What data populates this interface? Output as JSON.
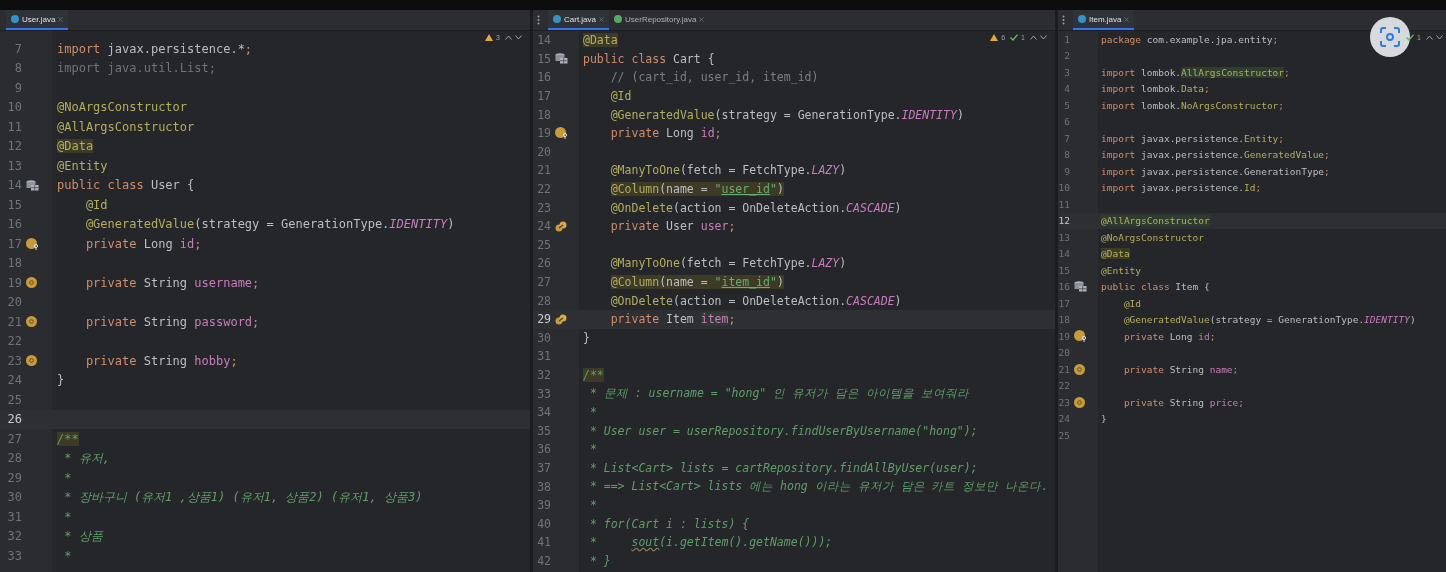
{
  "panes": [
    {
      "tabs": [
        {
          "label": "User.java",
          "kind": "class",
          "selected": true
        }
      ],
      "inspections": {
        "warnings": "3"
      },
      "lines": [
        {
          "number": "7",
          "current": false,
          "tokens": [
            {
              "text": "import",
              "kind": "keyword"
            },
            {
              "text": " javax.persistence.*",
              "kind": "plain"
            },
            {
              "text": ";",
              "kind": "punct"
            }
          ]
        },
        {
          "number": "8",
          "current": false,
          "tokens": [
            {
              "text": "import java.util.List;",
              "kind": "unused"
            }
          ]
        },
        {
          "number": "9",
          "current": false
        },
        {
          "number": "10",
          "current": false,
          "tokens": [
            {
              "text": "@NoArgsConstructor",
              "kind": "annotation"
            }
          ]
        },
        {
          "number": "11",
          "current": false,
          "tokens": [
            {
              "text": "@AllArgsConstructor",
              "kind": "annotation"
            }
          ]
        },
        {
          "number": "12",
          "current": false,
          "tokens": [
            {
              "text": "@Data",
              "kind": "annotation-hl"
            }
          ]
        },
        {
          "number": "13",
          "current": false,
          "tokens": [
            {
              "text": "@Entity",
              "kind": "annotation"
            }
          ]
        },
        {
          "number": "14",
          "current": false,
          "gutter": {
            "kind": "table"
          },
          "tokens": [
            {
              "text": "public class ",
              "kind": "keyword"
            },
            {
              "text": "User {",
              "kind": "plain"
            }
          ]
        },
        {
          "number": "15",
          "current": false,
          "tokens": [
            {
              "text": "    @Id",
              "kind": "annotation"
            }
          ]
        },
        {
          "number": "16",
          "current": false,
          "tokens": [
            {
              "text": "    @GeneratedValue",
              "kind": "annotation"
            },
            {
              "text": "(strategy = GenerationType.",
              "kind": "plain"
            },
            {
              "text": "IDENTITY",
              "kind": "constant"
            },
            {
              "text": ")",
              "kind": "plain"
            }
          ]
        },
        {
          "number": "17",
          "current": false,
          "gutter": {
            "kind": "id-field"
          },
          "tokens": [
            {
              "text": "    private ",
              "kind": "keyword"
            },
            {
              "text": "Long ",
              "kind": "plain"
            },
            {
              "text": "id",
              "kind": "field"
            },
            {
              "text": ";",
              "kind": "punct"
            }
          ]
        },
        {
          "number": "18",
          "current": false
        },
        {
          "number": "19",
          "current": false,
          "gutter": {
            "kind": "field"
          },
          "tokens": [
            {
              "text": "    private ",
              "kind": "keyword"
            },
            {
              "text": "String ",
              "kind": "plain"
            },
            {
              "text": "username",
              "kind": "field"
            },
            {
              "text": ";",
              "kind": "punct"
            }
          ]
        },
        {
          "number": "20",
          "current": false
        },
        {
          "number": "21",
          "current": false,
          "gutter": {
            "kind": "field"
          },
          "tokens": [
            {
              "text": "    private ",
              "kind": "keyword"
            },
            {
              "text": "String ",
              "kind": "plain"
            },
            {
              "text": "password",
              "kind": "field"
            },
            {
              "text": ";",
              "kind": "punct"
            }
          ]
        },
        {
          "number": "22",
          "current": false
        },
        {
          "number": "23",
          "current": false,
          "gutter": {
            "kind": "field"
          },
          "tokens": [
            {
              "text": "    private ",
              "kind": "keyword"
            },
            {
              "text": "String ",
              "kind": "plain"
            },
            {
              "text": "hobby",
              "kind": "field"
            },
            {
              "text": ";",
              "kind": "punct"
            }
          ]
        },
        {
          "number": "24",
          "current": false,
          "tokens": [
            {
              "text": "}",
              "kind": "plain"
            }
          ]
        },
        {
          "number": "25",
          "current": false
        },
        {
          "number": "26",
          "current": true
        },
        {
          "number": "27",
          "current": false,
          "tokens": [
            {
              "text": "/**",
              "kind": "doc-hl"
            }
          ]
        },
        {
          "number": "28",
          "current": false,
          "tokens": [
            {
              "text": " * 유저,",
              "kind": "doc"
            }
          ]
        },
        {
          "number": "29",
          "current": false,
          "tokens": [
            {
              "text": " *",
              "kind": "doc"
            }
          ]
        },
        {
          "number": "30",
          "current": false,
          "tokens": [
            {
              "text": " * 장바구니 (유저1 ,상품1) (유저1, 상품2) (유저1, 상품3)",
              "kind": "doc"
            }
          ]
        },
        {
          "number": "31",
          "current": false,
          "tokens": [
            {
              "text": " *",
              "kind": "doc"
            }
          ]
        },
        {
          "number": "32",
          "current": false,
          "tokens": [
            {
              "text": " * 상품",
              "kind": "doc"
            }
          ]
        },
        {
          "number": "33",
          "current": false,
          "tokens": [
            {
              "text": " *",
              "kind": "doc"
            }
          ]
        }
      ]
    },
    {
      "tabs": [
        {
          "label": "Cart.java",
          "kind": "class",
          "selected": true
        },
        {
          "label": "UserRepository.java",
          "kind": "interface",
          "selected": false
        }
      ],
      "inspections": {
        "warnings": "6",
        "passed": "1"
      },
      "lines": [
        {
          "number": "14",
          "current": false,
          "tokens": [
            {
              "text": "@Data",
              "kind": "annotation-hl"
            }
          ]
        },
        {
          "number": "15",
          "current": false,
          "gutter": {
            "kind": "table"
          },
          "tokens": [
            {
              "text": "public class ",
              "kind": "keyword"
            },
            {
              "text": "Cart {",
              "kind": "plain"
            }
          ]
        },
        {
          "number": "16",
          "current": false,
          "tokens": [
            {
              "text": "    // (cart_id, user_id, item_id)",
              "kind": "comment"
            }
          ]
        },
        {
          "number": "17",
          "current": false,
          "tokens": [
            {
              "text": "    @Id",
              "kind": "annotation"
            }
          ]
        },
        {
          "number": "18",
          "current": false,
          "tokens": [
            {
              "text": "    @GeneratedValue",
              "kind": "annotation"
            },
            {
              "text": "(strategy = GenerationType.",
              "kind": "plain"
            },
            {
              "text": "IDENTITY",
              "kind": "constant"
            },
            {
              "text": ")",
              "kind": "plain"
            }
          ]
        },
        {
          "number": "19",
          "current": false,
          "gutter": {
            "kind": "id-field"
          },
          "tokens": [
            {
              "text": "    private ",
              "kind": "keyword"
            },
            {
              "text": "Long ",
              "kind": "plain"
            },
            {
              "text": "id",
              "kind": "field"
            },
            {
              "text": ";",
              "kind": "punct"
            }
          ]
        },
        {
          "number": "20",
          "current": false
        },
        {
          "number": "21",
          "current": false,
          "tokens": [
            {
              "text": "    @ManyToOne",
              "kind": "annotation"
            },
            {
              "text": "(fetch = FetchType.",
              "kind": "plain"
            },
            {
              "text": "LAZY",
              "kind": "constant"
            },
            {
              "text": ")",
              "kind": "plain"
            }
          ]
        },
        {
          "number": "22",
          "current": false,
          "tokens": [
            {
              "text": "    @Column",
              "kind": "annotation-hl"
            },
            {
              "text": "(name = ",
              "kind": "plain-hl"
            },
            {
              "text": "\"",
              "kind": "string-hl"
            },
            {
              "text": "user_id",
              "kind": "string-ref-hl"
            },
            {
              "text": "\"",
              "kind": "string-hl"
            },
            {
              "text": ")",
              "kind": "plain-hl"
            }
          ]
        },
        {
          "number": "23",
          "current": false,
          "tokens": [
            {
              "text": "    @OnDelete",
              "kind": "annotation"
            },
            {
              "text": "(action = OnDeleteAction.",
              "kind": "plain"
            },
            {
              "text": "CASCADE",
              "kind": "constant"
            },
            {
              "text": ")",
              "kind": "plain"
            }
          ]
        },
        {
          "number": "24",
          "current": false,
          "gutter": {
            "kind": "relation"
          },
          "tokens": [
            {
              "text": "    private ",
              "kind": "keyword"
            },
            {
              "text": "User ",
              "kind": "plain"
            },
            {
              "text": "user",
              "kind": "field"
            },
            {
              "text": ";",
              "kind": "punct"
            }
          ]
        },
        {
          "number": "25",
          "current": false
        },
        {
          "number": "26",
          "current": false,
          "tokens": [
            {
              "text": "    @ManyToOne",
              "kind": "annotation"
            },
            {
              "text": "(fetch = FetchType.",
              "kind": "plain"
            },
            {
              "text": "LAZY",
              "kind": "constant"
            },
            {
              "text": ")",
              "kind": "plain"
            }
          ]
        },
        {
          "number": "27",
          "current": false,
          "tokens": [
            {
              "text": "    @Column",
              "kind": "annotation-hl"
            },
            {
              "text": "(name = ",
              "kind": "plain-hl"
            },
            {
              "text": "\"",
              "kind": "string-hl"
            },
            {
              "text": "item_id",
              "kind": "string-ref-hl"
            },
            {
              "text": "\"",
              "kind": "string-hl"
            },
            {
              "text": ")",
              "kind": "plain-hl"
            }
          ]
        },
        {
          "number": "28",
          "current": false,
          "tokens": [
            {
              "text": "    @OnDelete",
              "kind": "annotation"
            },
            {
              "text": "(action = OnDeleteAction.",
              "kind": "plain"
            },
            {
              "text": "CASCADE",
              "kind": "constant"
            },
            {
              "text": ")",
              "kind": "plain"
            }
          ]
        },
        {
          "number": "29",
          "current": true,
          "gutter": {
            "kind": "relation"
          },
          "tokens": [
            {
              "text": "    private ",
              "kind": "keyword"
            },
            {
              "text": "Item ",
              "kind": "plain"
            },
            {
              "text": "item",
              "kind": "field-hl"
            },
            {
              "text": ";",
              "kind": "punct"
            }
          ]
        },
        {
          "number": "30",
          "current": false,
          "tokens": [
            {
              "text": "}",
              "kind": "plain"
            }
          ]
        },
        {
          "number": "31",
          "current": false
        },
        {
          "number": "32",
          "current": false,
          "tokens": [
            {
              "text": "/**",
              "kind": "doc-hl"
            }
          ]
        },
        {
          "number": "33",
          "current": false,
          "tokens": [
            {
              "text": " * 문제 : username = \"hong\" 인 유저가 담은 아이템을 보여줘라",
              "kind": "doc"
            }
          ]
        },
        {
          "number": "34",
          "current": false,
          "tokens": [
            {
              "text": " *",
              "kind": "doc"
            }
          ]
        },
        {
          "number": "35",
          "current": false,
          "tokens": [
            {
              "text": " * User user = userRepository.findUserByUsername(\"hong\");",
              "kind": "doc"
            }
          ]
        },
        {
          "number": "36",
          "current": false,
          "tokens": [
            {
              "text": " *",
              "kind": "doc"
            }
          ]
        },
        {
          "number": "37",
          "current": false,
          "tokens": [
            {
              "text": " * List<Cart> lists = cartRepository.findAllByUser(user);",
              "kind": "doc"
            }
          ]
        },
        {
          "number": "38",
          "current": false,
          "tokens": [
            {
              "text": " * ==> List<Cart> lists 에는 hong 이라는 유저가 담은 카트 정보만 나온다.",
              "kind": "doc"
            }
          ]
        },
        {
          "number": "39",
          "current": false,
          "tokens": [
            {
              "text": " *",
              "kind": "doc"
            }
          ]
        },
        {
          "number": "40",
          "current": false,
          "tokens": [
            {
              "text": " * for(Cart i : lists) {",
              "kind": "doc"
            }
          ]
        },
        {
          "number": "41",
          "current": false,
          "tokens": [
            {
              "text": " *     ",
              "kind": "doc"
            },
            {
              "text": "sout",
              "kind": "doc-squiggle"
            },
            {
              "text": "(i.getItem().getName()));",
              "kind": "doc"
            }
          ]
        },
        {
          "number": "42",
          "current": false,
          "tokens": [
            {
              "text": " * }",
              "kind": "doc"
            }
          ]
        }
      ]
    },
    {
      "tabs": [
        {
          "label": "Item.java",
          "kind": "class",
          "selected": true
        }
      ],
      "inspections": {
        "passed": "1"
      },
      "lines": [
        {
          "number": "1",
          "current": false,
          "tokens": [
            {
              "text": "package ",
              "kind": "keyword"
            },
            {
              "text": "com.example.jpa.entity",
              "kind": "plain"
            },
            {
              "text": ";",
              "kind": "punct"
            }
          ]
        },
        {
          "number": "2",
          "current": false
        },
        {
          "number": "3",
          "current": false,
          "tokens": [
            {
              "text": "import ",
              "kind": "keyword"
            },
            {
              "text": "lombok.",
              "kind": "plain"
            },
            {
              "text": "AllArgsConstructor",
              "kind": "annotation-hl-alt"
            },
            {
              "text": ";",
              "kind": "punct"
            }
          ]
        },
        {
          "number": "4",
          "current": false,
          "tokens": [
            {
              "text": "import ",
              "kind": "keyword"
            },
            {
              "text": "lombok.",
              "kind": "plain"
            },
            {
              "text": "Data",
              "kind": "annotation"
            },
            {
              "text": ";",
              "kind": "punct"
            }
          ]
        },
        {
          "number": "5",
          "current": false,
          "tokens": [
            {
              "text": "import ",
              "kind": "keyword"
            },
            {
              "text": "lombok.",
              "kind": "plain"
            },
            {
              "text": "NoArgsConstructor",
              "kind": "annotation"
            },
            {
              "text": ";",
              "kind": "punct"
            }
          ]
        },
        {
          "number": "6",
          "current": false
        },
        {
          "number": "7",
          "current": false,
          "tokens": [
            {
              "text": "import ",
              "kind": "keyword"
            },
            {
              "text": "javax.persistence.",
              "kind": "plain"
            },
            {
              "text": "Entity",
              "kind": "annotation"
            },
            {
              "text": ";",
              "kind": "punct"
            }
          ]
        },
        {
          "number": "8",
          "current": false,
          "tokens": [
            {
              "text": "import ",
              "kind": "keyword"
            },
            {
              "text": "javax.persistence.",
              "kind": "plain"
            },
            {
              "text": "GeneratedValue",
              "kind": "annotation"
            },
            {
              "text": ";",
              "kind": "punct"
            }
          ]
        },
        {
          "number": "9",
          "current": false,
          "tokens": [
            {
              "text": "import ",
              "kind": "keyword"
            },
            {
              "text": "javax.persistence.",
              "kind": "plain"
            },
            {
              "text": "GenerationType",
              "kind": "plain"
            },
            {
              "text": ";",
              "kind": "punct"
            }
          ]
        },
        {
          "number": "10",
          "current": false,
          "tokens": [
            {
              "text": "import ",
              "kind": "keyword"
            },
            {
              "text": "javax.persistence.",
              "kind": "plain"
            },
            {
              "text": "Id",
              "kind": "annotation"
            },
            {
              "text": ";",
              "kind": "punct"
            }
          ]
        },
        {
          "number": "11",
          "current": false
        },
        {
          "number": "12",
          "current": true,
          "tokens": [
            {
              "text": "@AllArgsConstructor",
              "kind": "annotation-hl-alt"
            }
          ]
        },
        {
          "number": "13",
          "current": false,
          "tokens": [
            {
              "text": "@NoArgsConstructor",
              "kind": "annotation"
            }
          ]
        },
        {
          "number": "14",
          "current": false,
          "tokens": [
            {
              "text": "@Data",
              "kind": "annotation-hl"
            }
          ]
        },
        {
          "number": "15",
          "current": false,
          "tokens": [
            {
              "text": "@Entity",
              "kind": "annotation"
            }
          ]
        },
        {
          "number": "16",
          "current": false,
          "gutter": {
            "kind": "table"
          },
          "tokens": [
            {
              "text": "public class ",
              "kind": "keyword"
            },
            {
              "text": "Item {",
              "kind": "plain"
            }
          ]
        },
        {
          "number": "17",
          "current": false,
          "tokens": [
            {
              "text": "    @Id",
              "kind": "annotation"
            }
          ]
        },
        {
          "number": "18",
          "current": false,
          "tokens": [
            {
              "text": "    @GeneratedValue",
              "kind": "annotation"
            },
            {
              "text": "(strategy = GenerationType.",
              "kind": "plain"
            },
            {
              "text": "IDENTITY",
              "kind": "constant"
            },
            {
              "text": ")",
              "kind": "plain"
            }
          ]
        },
        {
          "number": "19",
          "current": false,
          "gutter": {
            "kind": "id-field"
          },
          "tokens": [
            {
              "text": "    private ",
              "kind": "keyword"
            },
            {
              "text": "Long ",
              "kind": "plain"
            },
            {
              "text": "id",
              "kind": "field"
            },
            {
              "text": ";",
              "kind": "punct"
            }
          ]
        },
        {
          "number": "20",
          "current": false
        },
        {
          "number": "21",
          "current": false,
          "gutter": {
            "kind": "field"
          },
          "tokens": [
            {
              "text": "    private ",
              "kind": "keyword"
            },
            {
              "text": "String ",
              "kind": "plain"
            },
            {
              "text": "name",
              "kind": "field"
            },
            {
              "text": ";",
              "kind": "punct"
            }
          ]
        },
        {
          "number": "22",
          "current": false
        },
        {
          "number": "23",
          "current": false,
          "gutter": {
            "kind": "field"
          },
          "tokens": [
            {
              "text": "    private ",
              "kind": "keyword"
            },
            {
              "text": "String ",
              "kind": "plain"
            },
            {
              "text": "price",
              "kind": "field"
            },
            {
              "text": ";",
              "kind": "punct"
            }
          ]
        },
        {
          "number": "24",
          "current": false,
          "tokens": [
            {
              "text": "}",
              "kind": "plain"
            }
          ]
        },
        {
          "number": "25",
          "current": false
        }
      ]
    }
  ]
}
